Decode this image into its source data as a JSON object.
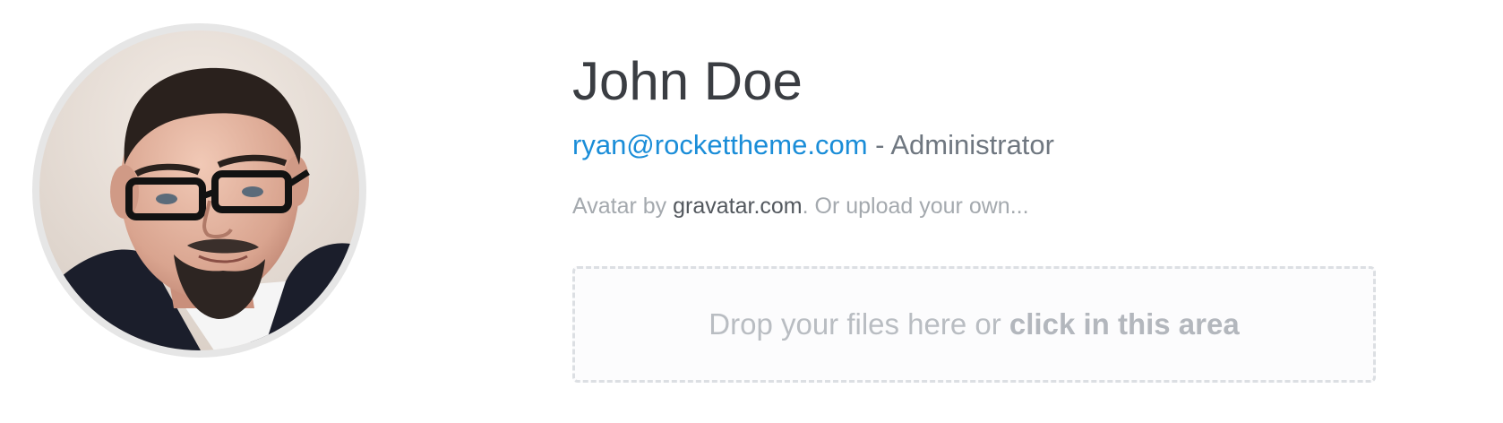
{
  "profile": {
    "name": "John Doe",
    "email": "ryan@rockettheme.com",
    "role_separator": " - ",
    "role": "Administrator"
  },
  "avatar_note": {
    "prefix": "Avatar by ",
    "link": "gravatar.com",
    "suffix": ". Or upload your own..."
  },
  "dropzone": {
    "text": "Drop your files here or ",
    "emphasis": "click in this area"
  },
  "colors": {
    "link": "#1a8dd8",
    "name": "#3a3d42",
    "muted": "#a4a9ae",
    "dropzone_border": "#dcdfe3"
  },
  "icons": {
    "avatar": "user-avatar-photo"
  }
}
